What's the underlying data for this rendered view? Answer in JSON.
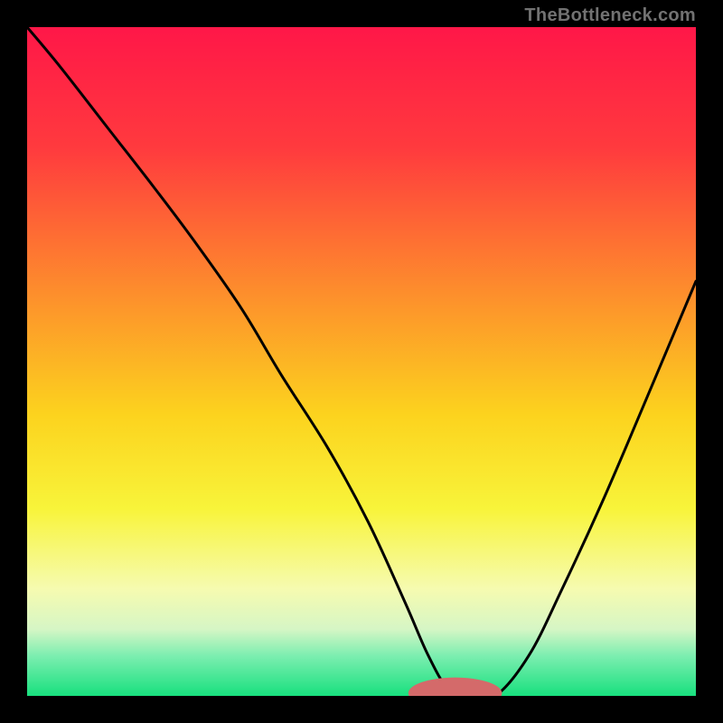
{
  "watermark": "TheBottleneck.com",
  "chart_data": {
    "type": "line",
    "title": "",
    "xlabel": "",
    "ylabel": "",
    "xlim": [
      0,
      100
    ],
    "ylim": [
      0,
      100
    ],
    "grid": false,
    "legend": false,
    "gradient_stops": [
      {
        "offset": 0,
        "color": "#ff1748"
      },
      {
        "offset": 18,
        "color": "#ff3a3e"
      },
      {
        "offset": 40,
        "color": "#fd8f2c"
      },
      {
        "offset": 58,
        "color": "#fcd31e"
      },
      {
        "offset": 72,
        "color": "#f8f43a"
      },
      {
        "offset": 84,
        "color": "#f6fbb0"
      },
      {
        "offset": 90,
        "color": "#d6f6c5"
      },
      {
        "offset": 94,
        "color": "#7ceeb0"
      },
      {
        "offset": 100,
        "color": "#18e07e"
      }
    ],
    "series": [
      {
        "name": "bottleneck-curve",
        "x": [
          0,
          5,
          12,
          19,
          25,
          32,
          38,
          45,
          51,
          56.5,
          60,
          63,
          66,
          70,
          75,
          80,
          86,
          92,
          100
        ],
        "y": [
          100,
          94,
          85,
          76,
          68,
          58,
          48,
          37,
          26,
          14,
          6,
          1,
          0,
          0,
          6,
          16,
          29,
          43,
          62
        ]
      }
    ],
    "marker": {
      "x": 64,
      "y": 0,
      "color": "#d46a6a",
      "rx": 7,
      "ry": 4
    }
  }
}
